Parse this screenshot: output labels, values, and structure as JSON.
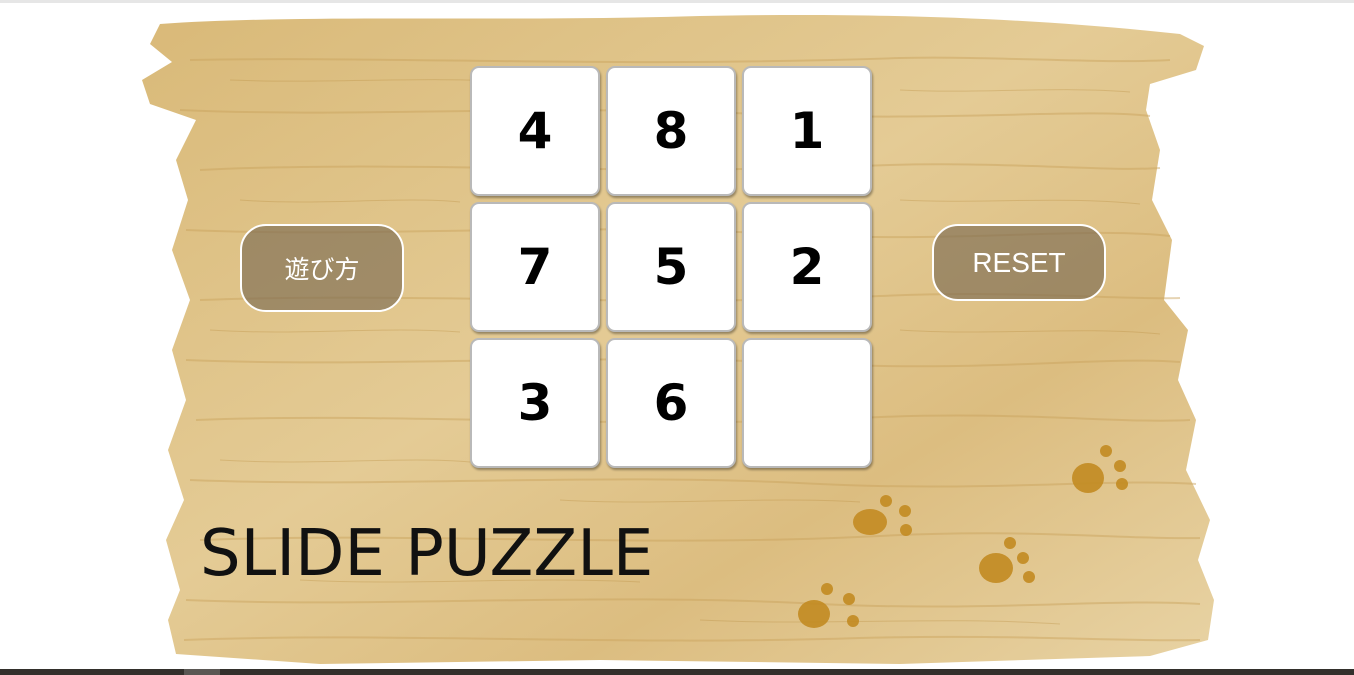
{
  "game": {
    "title": "SLIDE PUZZLE",
    "how_to_play_label": "遊び方",
    "reset_label": "RESET",
    "tiles": [
      "4",
      "8",
      "1",
      "7",
      "5",
      "2",
      "3",
      "6",
      ""
    ]
  },
  "colors": {
    "board_wood": "#dcbc7c",
    "board_grain": "#c9a25b",
    "paw_print": "#c38b22",
    "button_fill": "#7a6850",
    "tile_face": "#ffffff"
  },
  "decorations": {
    "paw_prints": [
      "paw-print-icon",
      "paw-print-icon",
      "paw-print-icon",
      "paw-print-icon"
    ]
  }
}
